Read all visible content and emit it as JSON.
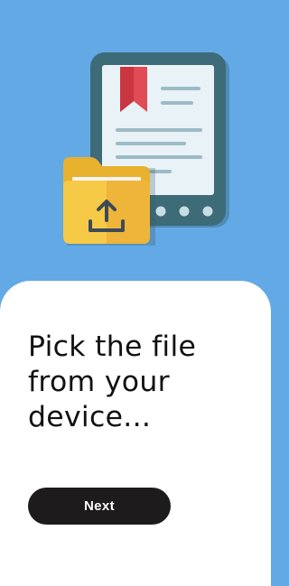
{
  "onboarding": {
    "headline": "Pick the file from your device...",
    "next_label": "Next"
  },
  "illustration": {
    "tablet_icon": "ebook-reader-icon",
    "bookmark_icon": "bookmark-icon",
    "folder_icon": "upload-folder-icon",
    "upload_icon": "upload-arrow-icon"
  },
  "colors": {
    "background": "#63a9e6",
    "sheet": "#ffffff",
    "button": "#1d1b1c",
    "button_text": "#ffffff",
    "headline": "#111111",
    "tablet_frame": "#3e6b78",
    "screen": "#e9f2f6",
    "bookmark": "#e14b55",
    "folder": "#f6c946"
  }
}
